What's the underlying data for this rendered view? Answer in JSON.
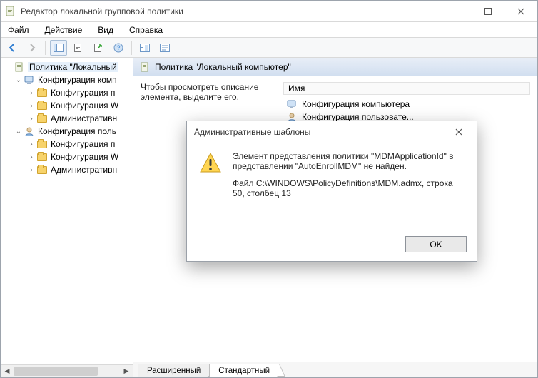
{
  "window": {
    "title": "Редактор локальной групповой политики"
  },
  "menu": {
    "file": "Файл",
    "action": "Действие",
    "view": "Вид",
    "help": "Справка"
  },
  "tree": {
    "root": "Политика \"Локальный",
    "group1": "Конфигурация комп",
    "g1_a": "Конфигурация п",
    "g1_b": "Конфигурация W",
    "g1_c": "Административн",
    "group2": "Конфигурация поль",
    "g2_a": "Конфигурация п",
    "g2_b": "Конфигурация W",
    "g2_c": "Административн"
  },
  "view": {
    "header": "Политика \"Локальный компьютер\"",
    "description": "Чтобы просмотреть описание элемента, выделите его.",
    "column_name": "Имя",
    "row1": "Конфигурация компьютера",
    "row2": "Конфигурация пользовате..."
  },
  "tabs": {
    "extended": "Расширенный",
    "standard": "Стандартный"
  },
  "dialog": {
    "title": "Административные шаблоны",
    "line1": "Элемент представления политики \"MDMApplicationId\" в представлении \"AutoEnrollMDM\" не найден.",
    "line2": "Файл C:\\WINDOWS\\PolicyDefinitions\\MDM.admx, строка 50, столбец 13",
    "ok": "OK"
  }
}
